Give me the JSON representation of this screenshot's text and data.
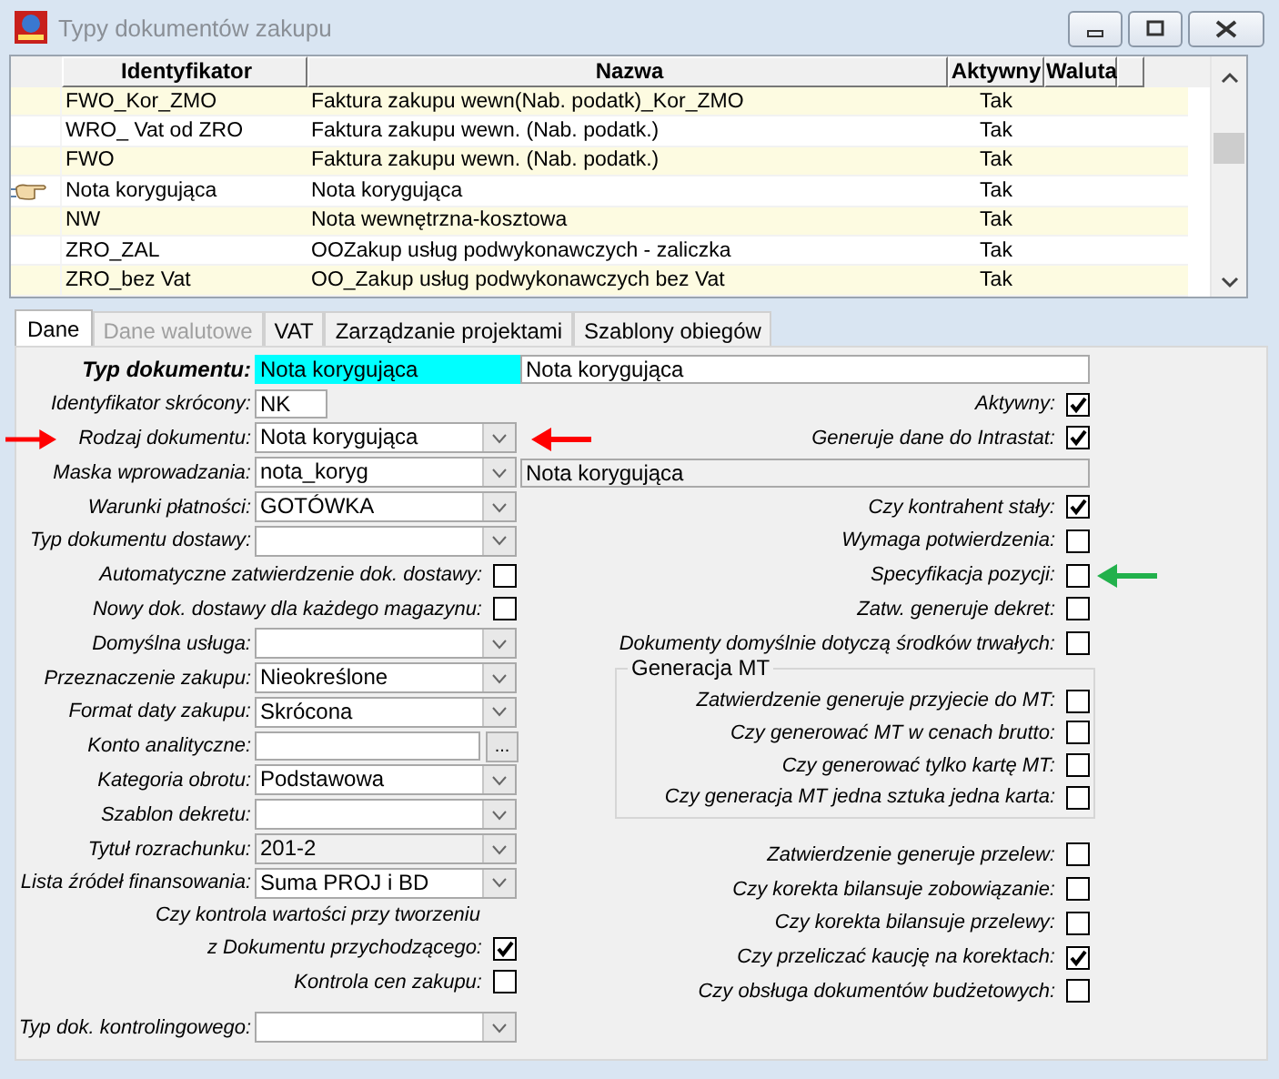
{
  "window": {
    "title": "Typy dokumentów zakupu"
  },
  "table": {
    "columns": [
      "Identyfikator",
      "Nazwa",
      "Aktywny",
      "Waluta"
    ],
    "rows": [
      {
        "cells": [
          "FWO_Kor_ZMO",
          "Faktura zakupu wewn(Nab. podatk)_Kor_ZMO",
          "Tak"
        ],
        "selected": false
      },
      {
        "cells": [
          "WRO_ Vat od ZRO",
          "Faktura zakupu wewn. (Nab. podatk.)",
          "Tak"
        ],
        "selected": false
      },
      {
        "cells": [
          "FWO",
          "Faktura zakupu wewn. (Nab. podatk.)",
          "Tak"
        ],
        "selected": false
      },
      {
        "cells": [
          "Nota korygująca",
          "Nota korygująca",
          "Tak"
        ],
        "selected": true
      },
      {
        "cells": [
          "NW",
          "Nota wewnętrzna-kosztowa",
          "Tak"
        ],
        "selected": false
      },
      {
        "cells": [
          "ZRO_ZAL",
          "OOZakup usług podwykonawczych - zaliczka",
          "Tak"
        ],
        "selected": false
      },
      {
        "cells": [
          "ZRO_bez Vat",
          "OO_Zakup usług podwykonawczych bez Vat",
          "Tak"
        ],
        "selected": false
      }
    ]
  },
  "tabs": [
    {
      "label": "Dane",
      "selected": true,
      "disabled": false
    },
    {
      "label": "Dane walutowe",
      "selected": false,
      "disabled": true
    },
    {
      "label": "VAT",
      "selected": false,
      "disabled": false
    },
    {
      "label": "Zarządzanie projektami",
      "selected": false,
      "disabled": false
    },
    {
      "label": "Szablony obiegów",
      "selected": false,
      "disabled": false
    }
  ],
  "form_left": [
    {
      "kind": "primary",
      "label": "Typ dokumentu:",
      "value": "Nota korygująca"
    },
    {
      "kind": "text",
      "label": "Identyfikator skrócony:",
      "value": "NK"
    },
    {
      "kind": "combo",
      "label": "Rodzaj dokumentu:",
      "value": "Nota korygująca",
      "disabled": false,
      "color": "#ff0000"
    },
    {
      "kind": "combo",
      "label": "Maska wprowadzania:",
      "value": "nota_koryg",
      "disabled": false
    },
    {
      "kind": "combo",
      "label": "Warunki płatności:",
      "value": "GOTÓWKA",
      "disabled": false
    },
    {
      "kind": "combo",
      "label": "Typ dokumentu dostawy:",
      "disabled": false
    },
    {
      "kind": "checkbox",
      "label": "Automatyczne zatwierdzenie dok. dostawy:",
      "checked": false
    },
    {
      "kind": "checkbox",
      "label": "Nowy dok. dostawy dla każdego magazynu:",
      "checked": false
    },
    {
      "kind": "combo",
      "label": "Domyślna usługa:",
      "disabled": false
    },
    {
      "kind": "combo",
      "label": "Przeznaczenie zakupu:",
      "value": "Nieokreślone",
      "disabled": false
    },
    {
      "kind": "combo",
      "label": "Format daty zakupu:",
      "value": "Skrócona",
      "disabled": false
    },
    {
      "kind": "browse",
      "label": "Konto analityczne:",
      "button": "..."
    },
    {
      "kind": "combo",
      "label": "Kategoria obrotu:",
      "value": "Podstawowa",
      "disabled": false
    },
    {
      "kind": "combo",
      "label": "Szablon dekretu:",
      "disabled": false
    },
    {
      "kind": "combo",
      "label": "Tytuł rozrachunku:",
      "value": "201-2",
      "disabled": true
    },
    {
      "kind": "combo",
      "label": "Lista źródeł finansowania:",
      "value": "Suma PROJ i BD",
      "disabled": false
    },
    {
      "kind": "note",
      "label": "Czy kontrola wartości przy tworzeniu"
    },
    {
      "kind": "checkbox",
      "label": "z Dokumentu przychodzącego:",
      "checked": true
    },
    {
      "kind": "checkbox",
      "label": "Kontrola cen zakupu:",
      "checked": false
    },
    {
      "kind": "combo",
      "label": "Typ dok. kontrolingowego:",
      "disabled": false
    }
  ],
  "form_right": [
    {
      "kind": "field",
      "value": "Nota korygująca",
      "disabled": false
    },
    {
      "kind": "checkbox",
      "label": "Aktywny:",
      "checked": true
    },
    {
      "kind": "checkbox",
      "label": "Generuje dane do Intrastat:",
      "checked": true
    },
    {
      "kind": "field",
      "value": "Nota korygująca",
      "disabled": true
    },
    {
      "kind": "checkbox",
      "label": "Czy kontrahent stały:",
      "checked": true
    },
    {
      "kind": "checkbox",
      "label": "Wymaga potwierdzenia:",
      "checked": false
    },
    {
      "kind": "checkbox",
      "label": "Specyfikacja pozycji:",
      "checked": false,
      "color": "#22b14c"
    },
    {
      "kind": "checkbox",
      "label": "Zatw. generuje dekret:",
      "checked": false
    },
    {
      "kind": "checkbox",
      "label": "Dokumenty domyślnie dotyczą środków trwałych:",
      "checked": false
    },
    {
      "kind": "group",
      "title": "Generacja MT",
      "items": [
        {
          "kind": "checkbox",
          "label": "Zatwierdzenie generuje przyjecie do MT:",
          "checked": false
        },
        {
          "kind": "checkbox",
          "label": "Czy generować MT w cenach brutto:",
          "checked": false
        },
        {
          "kind": "checkbox",
          "label": "Czy generować tylko kartę MT:",
          "checked": false
        },
        {
          "kind": "checkbox",
          "label": "Czy generacja MT jedna sztuka jedna karta:",
          "checked": false
        }
      ]
    },
    {
      "kind": "checkbox",
      "label": "Zatwierdzenie generuje przelew:",
      "checked": false
    },
    {
      "kind": "checkbox",
      "label": "Czy korekta bilansuje zobowiązanie:",
      "checked": false
    },
    {
      "kind": "checkbox",
      "label": "Czy korekta bilansuje przelewy:",
      "checked": false
    },
    {
      "kind": "checkbox",
      "label": "Czy przeliczać kaucję na korektach:",
      "checked": true
    },
    {
      "kind": "checkbox",
      "label": "Czy obsługa dokumentów budżetowych:",
      "checked": false
    }
  ]
}
